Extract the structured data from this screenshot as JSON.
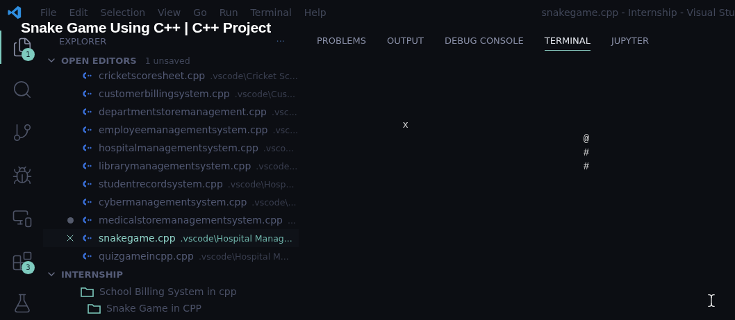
{
  "caption": "Snake Game Using C++ | C++ Project",
  "menu": [
    "File",
    "Edit",
    "Selection",
    "View",
    "Go",
    "Run",
    "Terminal",
    "Help"
  ],
  "window": {
    "title": "snakegame.cpp - Internship - Visual Stu"
  },
  "activity_bar": [
    {
      "kind": "files",
      "selected": true,
      "badge": "1"
    },
    {
      "kind": "search",
      "selected": false
    },
    {
      "kind": "source",
      "selected": false
    },
    {
      "kind": "debug",
      "selected": false
    },
    {
      "kind": "remote",
      "selected": false
    },
    {
      "kind": "extensions",
      "selected": false,
      "badge": "3"
    },
    {
      "kind": "testing",
      "selected": false
    }
  ],
  "sidebar": {
    "title": "EXPLORER",
    "more": "···",
    "open_editors": {
      "title": "OPEN EDITORS",
      "note": "1 unsaved",
      "expanded": true,
      "items": [
        {
          "name": "cricketscoresheet.cpp",
          "path": ".vscode\\Cricket Sc...",
          "unsaved": false,
          "selected": false
        },
        {
          "name": "customerbillingsystem.cpp",
          "path": ".vscode\\Cus...",
          "unsaved": false,
          "selected": false
        },
        {
          "name": "departmentstoremanagement.cpp",
          "path": ".vsc...",
          "unsaved": false,
          "selected": false
        },
        {
          "name": "employeemanagementsystem.cpp",
          "path": ".vsc...",
          "unsaved": false,
          "selected": false
        },
        {
          "name": "hospitalmanagementsystem.cpp",
          "path": ".vsco...",
          "unsaved": false,
          "selected": false
        },
        {
          "name": "librarymanagementsystem.cpp",
          "path": ".vscode...",
          "unsaved": false,
          "selected": false
        },
        {
          "name": "studentrecordsystem.cpp",
          "path": ".vscode\\Hosp...",
          "unsaved": false,
          "selected": false
        },
        {
          "name": "cybermanagementsystem.cpp",
          "path": ".vscode\\...",
          "unsaved": false,
          "selected": false
        },
        {
          "name": "medicalstoremanagementsystem.cpp",
          "path": "...",
          "unsaved": true,
          "selected": false
        },
        {
          "name": "snakegame.cpp",
          "path": ".vscode\\Hospital Manag...",
          "unsaved": false,
          "selected": true
        },
        {
          "name": "quizgameincpp.cpp",
          "path": ".vscode\\Hospital M...",
          "unsaved": false,
          "selected": false
        }
      ]
    },
    "workspace": {
      "title": "INTERNSHIP",
      "expanded": true,
      "items": [
        {
          "name": "School Billing System in cpp"
        },
        {
          "name": "Snake Game in CPP"
        }
      ]
    }
  },
  "panel": {
    "tabs": [
      {
        "label": "PROBLEMS",
        "selected": false
      },
      {
        "label": "OUTPUT",
        "selected": false
      },
      {
        "label": "DEBUG CONSOLE",
        "selected": false
      },
      {
        "label": "TERMINAL",
        "selected": true
      },
      {
        "label": "JUPYTER",
        "selected": false
      }
    ],
    "terminal_lines": [
      "                x",
      "                                               @",
      "                                               #",
      "                                               #"
    ]
  }
}
